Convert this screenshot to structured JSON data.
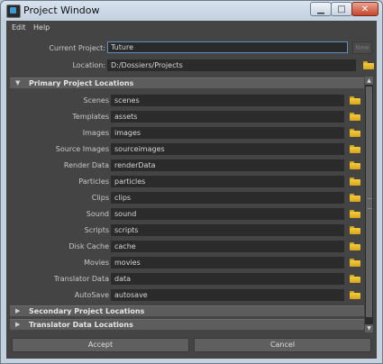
{
  "window": {
    "title": "Project Window"
  },
  "menu": [
    "Edit",
    "Help"
  ],
  "current_project": {
    "label": "Current Project:",
    "value": "Tuture",
    "new_label": "New"
  },
  "location": {
    "label": "Location:",
    "value": "D:/Dossiers/Projects"
  },
  "sections": {
    "primary": "Primary Project Locations",
    "secondary": "Secondary Project Locations",
    "translator": "Translator Data Locations"
  },
  "rows": [
    {
      "label": "Scenes",
      "value": "scenes"
    },
    {
      "label": "Templates",
      "value": "assets"
    },
    {
      "label": "Images",
      "value": "images"
    },
    {
      "label": "Source Images",
      "value": "sourceimages"
    },
    {
      "label": "Render Data",
      "value": "renderData"
    },
    {
      "label": "Particles",
      "value": "particles"
    },
    {
      "label": "Clips",
      "value": "clips"
    },
    {
      "label": "Sound",
      "value": "sound"
    },
    {
      "label": "Scripts",
      "value": "scripts"
    },
    {
      "label": "Disk Cache",
      "value": "cache"
    },
    {
      "label": "Movies",
      "value": "movies"
    },
    {
      "label": "Translator Data",
      "value": "data"
    },
    {
      "label": "AutoSave",
      "value": "autosave"
    }
  ],
  "buttons": {
    "accept": "Accept",
    "cancel": "Cancel"
  },
  "icons": {
    "folder": "folder-icon",
    "app": "app-icon"
  },
  "colors": {
    "panel_bg": "#444444",
    "field_bg": "#2b2b2b",
    "folder": "#f2cc3b",
    "accent_border": "#5c8fc0"
  }
}
